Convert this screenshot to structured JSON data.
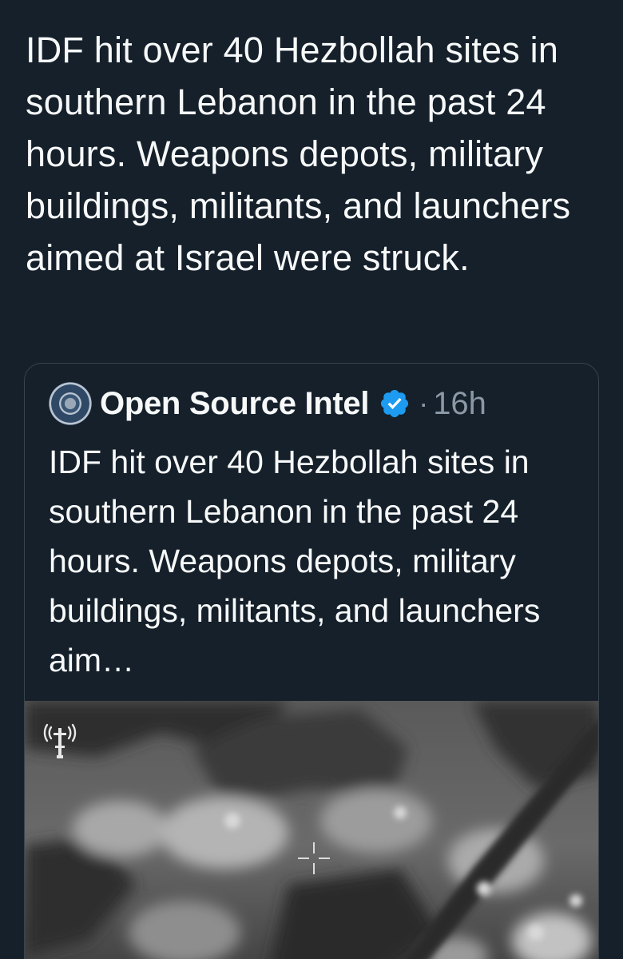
{
  "post": {
    "text": "IDF hit over 40 Hezbollah sites in southern Lebanon in the past 24 hours. Weapons depots, military buildings, militants, and launchers aimed at Israel were struck."
  },
  "quoted_post": {
    "author_name": "Open Source Intel",
    "separator": "·",
    "timestamp": "16h",
    "text": "IDF hit over 40 Hezbollah sites in southern Lebanon in the past 24 hours. Weapons depots, military buildings, militants, and launchers aim…",
    "avatar_icon": "seal-avatar",
    "verified_icon": "verified-badge-icon",
    "verified_color": "#1d9bf0"
  },
  "media": {
    "watermark_icon": "idf-logo-icon",
    "crosshair_icon": "crosshair-icon"
  },
  "colors": {
    "background": "#15202b",
    "text_primary": "#f7f9f9",
    "text_secondary": "#8b98a5",
    "border": "#38444d"
  }
}
